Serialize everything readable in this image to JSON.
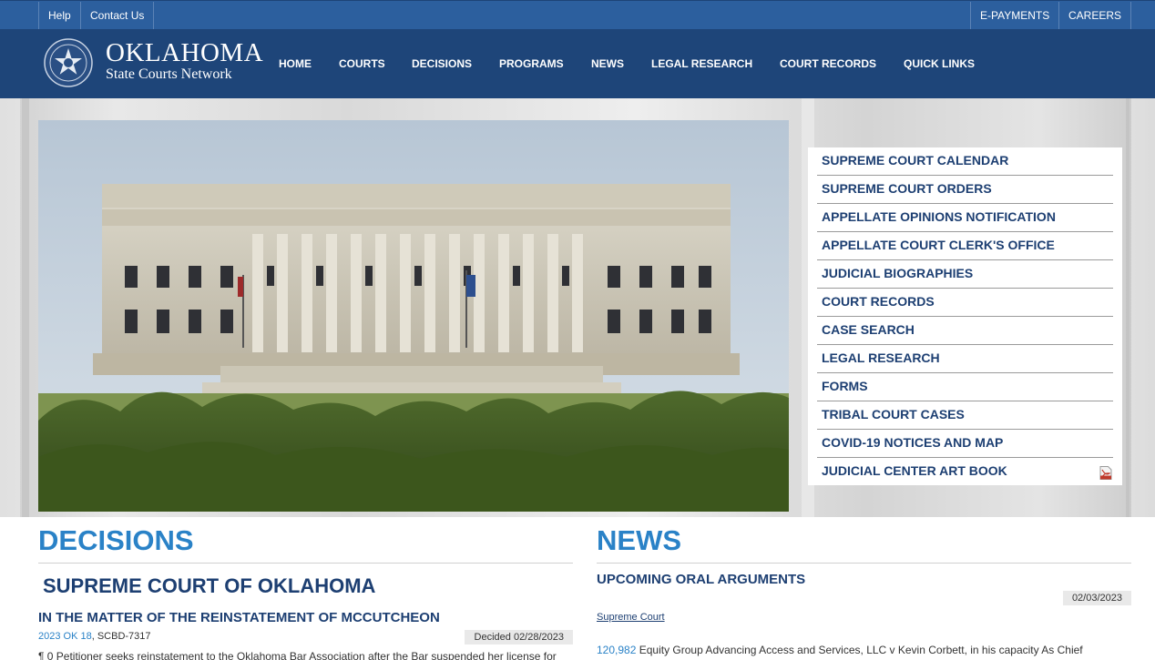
{
  "topbar": {
    "left": [
      "Help",
      "Contact Us"
    ],
    "right": [
      "E-PAYMENTS",
      "CAREERS"
    ]
  },
  "logo": {
    "title": "OKLAHOMA",
    "subtitle": "State Courts Network"
  },
  "nav": [
    "HOME",
    "COURTS",
    "DECISIONS",
    "PROGRAMS",
    "NEWS",
    "LEGAL RESEARCH",
    "COURT RECORDS",
    "QUICK LINKS"
  ],
  "quick_links": [
    "SUPREME COURT CALENDAR",
    "SUPREME COURT ORDERS",
    "APPELLATE OPINIONS NOTIFICATION",
    "APPELLATE COURT CLERK'S OFFICE",
    "JUDICIAL BIOGRAPHIES",
    "COURT RECORDS",
    "CASE SEARCH",
    "LEGAL RESEARCH",
    "FORMS",
    "TRIBAL COURT CASES",
    "COVID-19 NOTICES AND MAP",
    "JUDICIAL CENTER ART BOOK"
  ],
  "decisions": {
    "heading": "DECISIONS",
    "court": "SUPREME COURT OF OKLAHOMA",
    "case_title": "IN THE MATTER OF THE REINSTATEMENT OF MCCUTCHEON",
    "citation": "2023 OK 18",
    "docket": ", SCBD-7317",
    "decided": "Decided 02/28/2023",
    "summary": "¶ 0 Petitioner seeks reinstatement to the Oklahoma Bar Association after the Bar suspended her license for"
  },
  "news": {
    "heading": "NEWS",
    "subheading": "UPCOMING ORAL ARGUMENTS",
    "date": "02/03/2023",
    "court_link": "Supreme Court",
    "case_number": "120,982",
    "case_text": " Equity Group Advancing Access and Services, LLC v Kevin Corbett, in his capacity As Chief"
  },
  "colors": {
    "topbar": "#2c5f9e",
    "navbar": "#1e4579",
    "heading_blue": "#2a82c7",
    "link_navy": "#1d3f72"
  }
}
